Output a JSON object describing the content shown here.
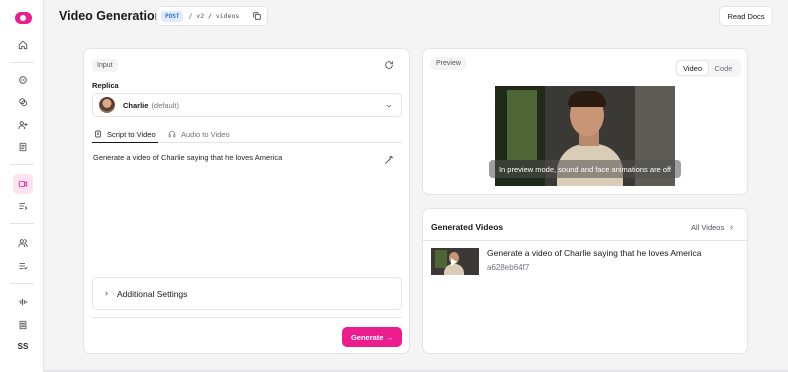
{
  "header": {
    "title": "Video Generation",
    "method": "POST",
    "path": "/ v2 / videos",
    "docs_label": "Read Docs"
  },
  "sidebar": {
    "items": [
      {
        "icon": "home-icon"
      },
      {
        "icon": "chat-icon"
      },
      {
        "icon": "chats-icon"
      },
      {
        "icon": "user-plus-icon"
      },
      {
        "icon": "document-icon"
      },
      {
        "icon": "video-camera-icon",
        "active": true
      },
      {
        "icon": "list-icon"
      },
      {
        "icon": "users-icon"
      },
      {
        "icon": "list-check-icon"
      },
      {
        "icon": "audio-wave-icon"
      },
      {
        "icon": "receipt-icon"
      }
    ],
    "user_initials": "SS"
  },
  "input_panel": {
    "chip": "Input",
    "replica_label": "Replica",
    "replica_name": "Charlie",
    "replica_suffix": "(default)",
    "tabs": [
      {
        "label": "Script to Video",
        "icon": "document-icon",
        "active": true
      },
      {
        "label": "Audio to Video",
        "icon": "headphones-icon",
        "active": false
      }
    ],
    "script_text": "Generate a video of Charlie saying that he loves America",
    "additional_settings_label": "Additional Settings",
    "generate_label": "Generate →"
  },
  "preview_panel": {
    "chip": "Preview",
    "toggle": [
      "Video",
      "Code"
    ],
    "toggle_selected": "Video",
    "overlay_text": "In preview mode, sound and face animations are off"
  },
  "generated_videos": {
    "title": "Generated Videos",
    "all_label": "All Videos",
    "items": [
      {
        "title": "Generate a video of Charlie saying that he loves America",
        "id": "a628eb64f7"
      }
    ]
  },
  "colors": {
    "accent": "#ec1e8f",
    "method_bg": "#e0ecfb",
    "method_text": "#3b6ed8"
  }
}
